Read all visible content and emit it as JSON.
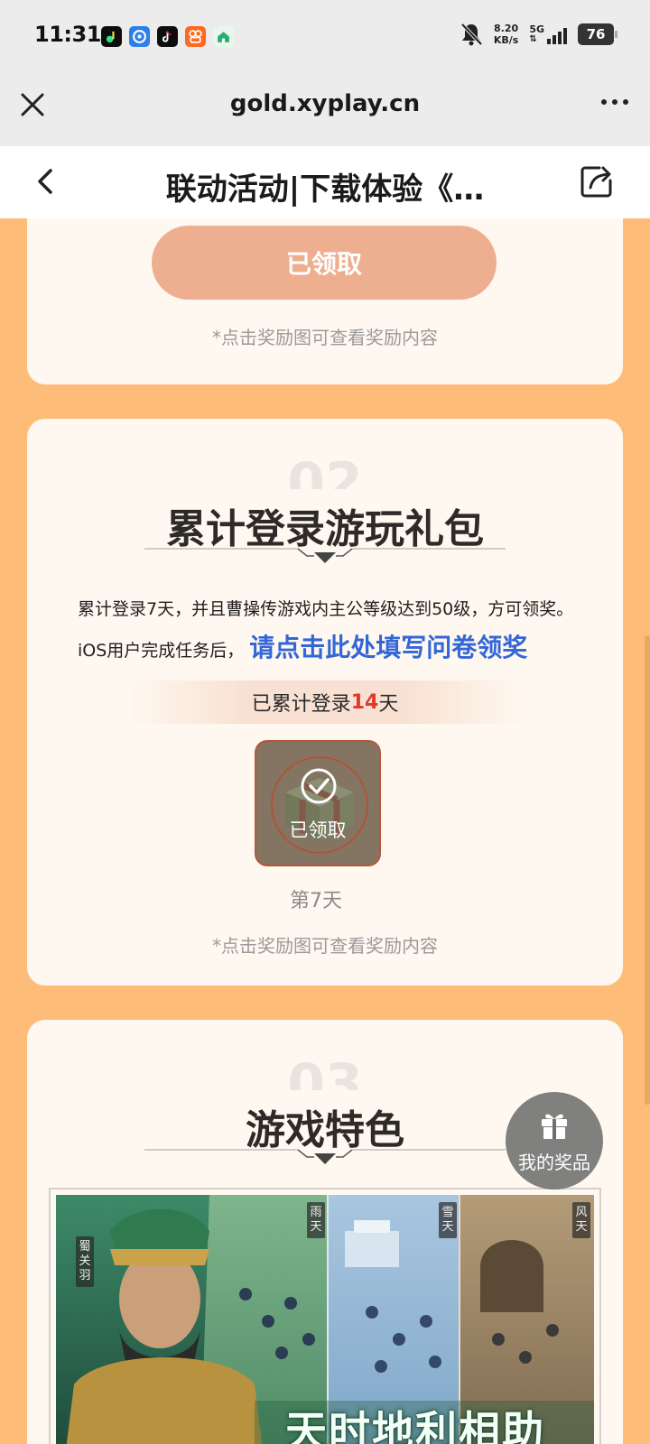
{
  "status_bar": {
    "time": "11:31",
    "net_speed_value": "8.20",
    "net_speed_unit": "KB/s",
    "network_type": "5G",
    "battery": "76"
  },
  "browser": {
    "url": "gold.xyplay.cn"
  },
  "header": {
    "title": "联动活动|下载体验《…"
  },
  "section1": {
    "button_label": "已领取",
    "hint": "*点击奖励图可查看奖励内容"
  },
  "section2": {
    "number": "02",
    "title": "累计登录游玩礼包",
    "description": "累计登录7天，并且曹操传游戏内主公等级达到50级，方可领奖。",
    "ios_prefix": "iOS用户完成任务后，",
    "survey_link": "请点击此处填写问卷领奖",
    "progress_prefix": "已累计登录",
    "progress_days": "14",
    "progress_suffix": "天",
    "reward_status": "已领取",
    "reward_day": "第7天",
    "hint": "*点击奖励图可查看奖励内容"
  },
  "section3": {
    "number": "03",
    "title": "游戏特色",
    "banner": {
      "hero_tag": "蜀 关羽",
      "weather_tags": [
        "雨天",
        "雪天",
        "风天"
      ],
      "slogan": "天时地利相助"
    }
  },
  "floating": {
    "my_prizes_label": "我的奖品"
  },
  "colors": {
    "page_bg": "#fdbd78",
    "card_bg": "#fff8f0",
    "claimed_button": "#eeae90",
    "link": "#3366d6",
    "highlight": "#e23a2a"
  }
}
